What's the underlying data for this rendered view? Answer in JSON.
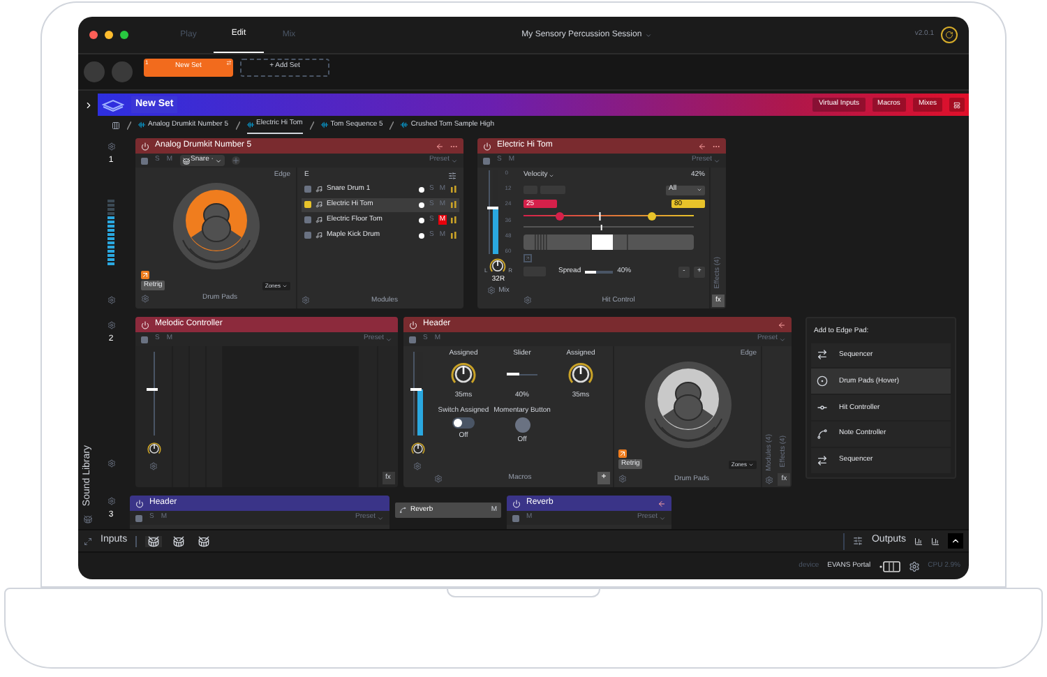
{
  "window": {
    "title": "My Sensory Percussion Session",
    "version": "v2.0.1"
  },
  "mode_tabs": [
    {
      "label": "Play",
      "selected": false
    },
    {
      "label": "Edit",
      "selected": true
    },
    {
      "label": "Mix",
      "selected": false
    }
  ],
  "sets": [
    {
      "number": "1",
      "label": "New Set",
      "selected": true
    }
  ],
  "add_set": "+ Add Set",
  "set_banner": {
    "title": "New Set",
    "buttons": [
      "Virtual Inputs",
      "Macros",
      "Mixes"
    ]
  },
  "breadcrumbs": [
    {
      "label": "Analog Drumkit Number 5",
      "selected": false
    },
    {
      "label": "Electric Hi Tom",
      "selected": true
    },
    {
      "label": "Tom Sequence 5",
      "selected": false
    },
    {
      "label": "Crushed Tom Sample High",
      "selected": false
    }
  ],
  "sidebar": {
    "label": "Sound Library"
  },
  "track_numbers": [
    "1",
    "2",
    "3"
  ],
  "drumkit": {
    "title": "Analog Drumkit Number 5",
    "color": "#7a2b2f",
    "enabled": false,
    "solo": "S",
    "mute": "M",
    "input": "Snare ·",
    "preset": "Preset",
    "edge": "Edge",
    "retrig": "Retrig",
    "zones": "Zones",
    "pads_label": "Drum Pads",
    "modules_head": "E",
    "modules_label": "Modules",
    "modules": [
      {
        "label": "Snare Drum 1",
        "solo": "S",
        "mute": "M",
        "selected": false,
        "muted": false
      },
      {
        "label": "Electric Hi Tom",
        "solo": "S",
        "mute": "M",
        "selected": true,
        "muted": false
      },
      {
        "label": "Electric Floor Tom",
        "solo": "S",
        "mute": "M",
        "selected": false,
        "muted": true
      },
      {
        "label": "Maple Kick Drum",
        "solo": "S",
        "mute": "M",
        "selected": false,
        "muted": false
      }
    ]
  },
  "hit_tom": {
    "title": "Electric Hi Tom",
    "color": "#7a2b2f",
    "enabled": false,
    "range": [
      {
        "level": 0.21
      },
      {
        "level": 0.75
      }
    ],
    "marker": {
      "level": 0.45
    },
    "position": {
      "level": 0.46
    },
    "solo": "S",
    "mute": "M",
    "preset": "Preset",
    "scale": [
      "0",
      "12",
      "24",
      "36",
      "48",
      "60"
    ],
    "pan_left": "L",
    "pan_right": "R",
    "pan_value": "32R",
    "mix_label": "Mix",
    "source": "Velocity",
    "percent": "42%",
    "filter": "All",
    "low": "25",
    "high": "80",
    "spread_label": "Spread",
    "spread": {
      "level": 0.4,
      "reading": "40%"
    },
    "minus": "-",
    "plus": "+",
    "footer": "Hit Control",
    "effects": "Effects (4)",
    "fx": "fx"
  },
  "melodic": {
    "title": "Melodic Controller",
    "color": "#8c2a3c",
    "enabled": false,
    "solo": "S",
    "mute": "M",
    "preset": "Preset",
    "fx": "fx"
  },
  "header": {
    "title": "Header",
    "color": "#7a2b2f",
    "enabled": false,
    "solo": "S",
    "mute": "M",
    "preset": "Preset",
    "macros_label": "Macros",
    "plus": "+",
    "edge": "Edge",
    "retrig": "Retrig",
    "zones": "Zones",
    "pads_label": "Drum Pads",
    "modules": "Modules (4)",
    "effects": "Effects (4)",
    "fx": "fx",
    "macros": [
      {
        "kind": "knob",
        "label": "Assigned",
        "reading": "35ms"
      },
      {
        "kind": "slider",
        "label": "Slider",
        "reading": "40%",
        "level": 0.4
      },
      {
        "kind": "knob",
        "label": "Assigned",
        "reading": "35ms"
      },
      {
        "kind": "switch",
        "label": "Switch Assigned",
        "on": false,
        "reading": "Off"
      },
      {
        "kind": "button",
        "label": "Momentary Button",
        "reading": "Off"
      }
    ]
  },
  "edge_menu": {
    "title": "Add to Edge Pad:",
    "items": [
      {
        "kind": "sequencer",
        "label": "Sequencer",
        "selected": false
      },
      {
        "kind": "drum_pads",
        "label": "Drum Pads (Hover)",
        "selected": true
      },
      {
        "kind": "hit_controller",
        "label": "Hit Controller",
        "selected": false
      },
      {
        "kind": "note_controller",
        "label": "Note Controller",
        "selected": false
      },
      {
        "kind": "sequencer",
        "label": "Sequencer",
        "selected": false
      }
    ]
  },
  "row3": {
    "header": {
      "title": "Header",
      "color": "#3a3488",
      "enabled": false,
      "solo": "S",
      "mute": "M",
      "preset": "Preset"
    },
    "reverb_chip": {
      "title": "Reverb",
      "mute": "M"
    },
    "reverb": {
      "title": "Reverb",
      "color": "#3a3488",
      "enabled": false,
      "mute": "M",
      "preset": "Preset"
    }
  },
  "io_bar": {
    "inputs": "Inputs",
    "outputs": "Outputs"
  },
  "status_bar": {
    "device_label": "device",
    "device": "EVANS Portal",
    "cpu": "CPU 2.9%"
  }
}
